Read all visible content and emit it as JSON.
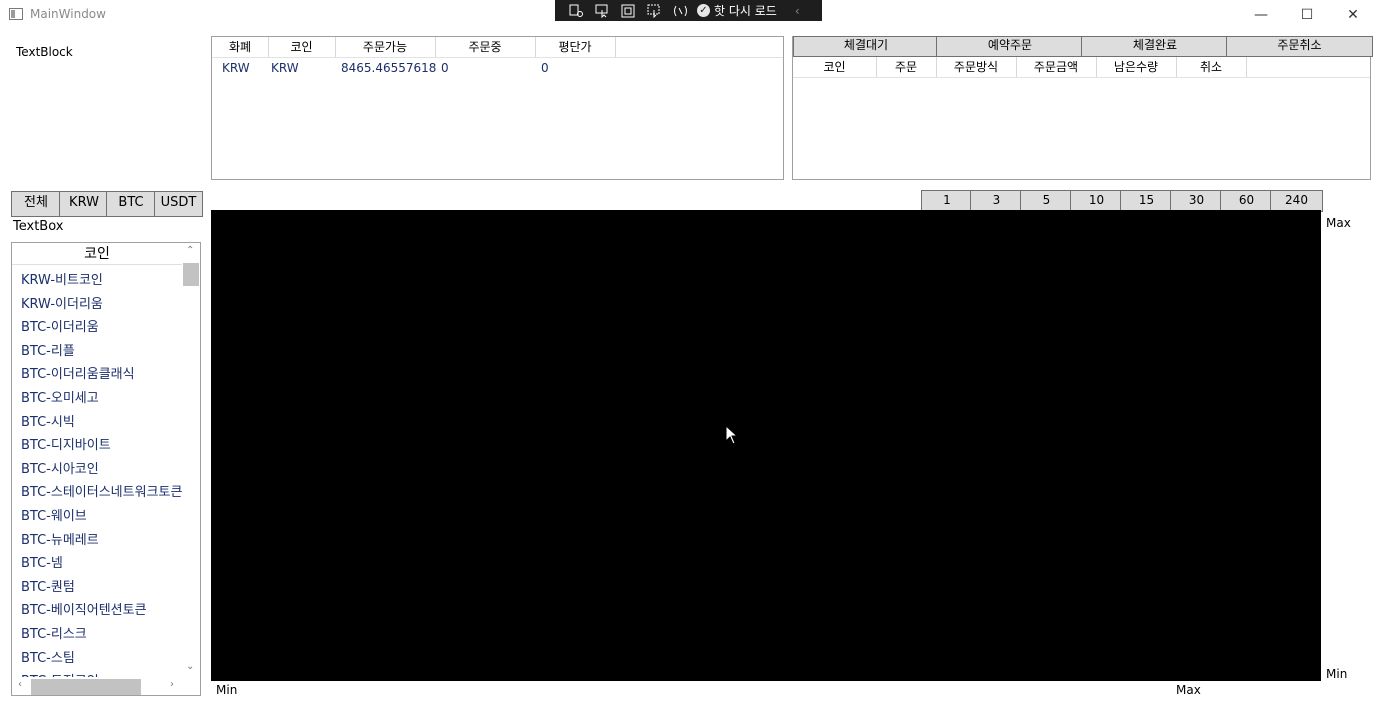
{
  "window": {
    "title": "MainWindow",
    "min_glyph": "—",
    "max_glyph": "☐",
    "close_glyph": "✕"
  },
  "debug_toolbar": {
    "hot_reload_label": "핫 다시 로드",
    "check_glyph": "✓",
    "collapse_glyph": "‹"
  },
  "textblock": "TextBlock",
  "balance_grid": {
    "headers": [
      "화폐",
      "코인",
      "주문가능",
      "주문중",
      "평단가"
    ],
    "rows": [
      [
        "KRW",
        "KRW",
        "8465.46557618",
        "0",
        "0"
      ]
    ]
  },
  "order_tabs": [
    "체결대기",
    "예약주문",
    "체결완료",
    "주문취소"
  ],
  "order_grid": {
    "headers": [
      "코인",
      "주문",
      "주문방식",
      "주문금액",
      "남은수량",
      "취소"
    ]
  },
  "filters": [
    "전체",
    "KRW",
    "BTC",
    "USDT"
  ],
  "search_box": "TextBox",
  "coin_list": {
    "header": "코인",
    "items": [
      "KRW-비트코인",
      "KRW-이더리움",
      "BTC-이더리움",
      "BTC-리플",
      "BTC-이더리움클래식",
      "BTC-오미세고",
      "BTC-시빅",
      "BTC-디지바이트",
      "BTC-시아코인",
      "BTC-스테이터스네트워크토큰",
      "BTC-웨이브",
      "BTC-뉴메레르",
      "BTC-넴",
      "BTC-퀀텀",
      "BTC-베이직어텐션토큰",
      "BTC-리스크",
      "BTC-스팀",
      "BTC-도지코인"
    ]
  },
  "intervals": [
    "1",
    "3",
    "5",
    "10",
    "15",
    "30",
    "60",
    "240"
  ],
  "chart_labels": {
    "right_max": "Max",
    "right_min": "Min",
    "bottom_min": "Min",
    "bottom_max": "Max"
  }
}
